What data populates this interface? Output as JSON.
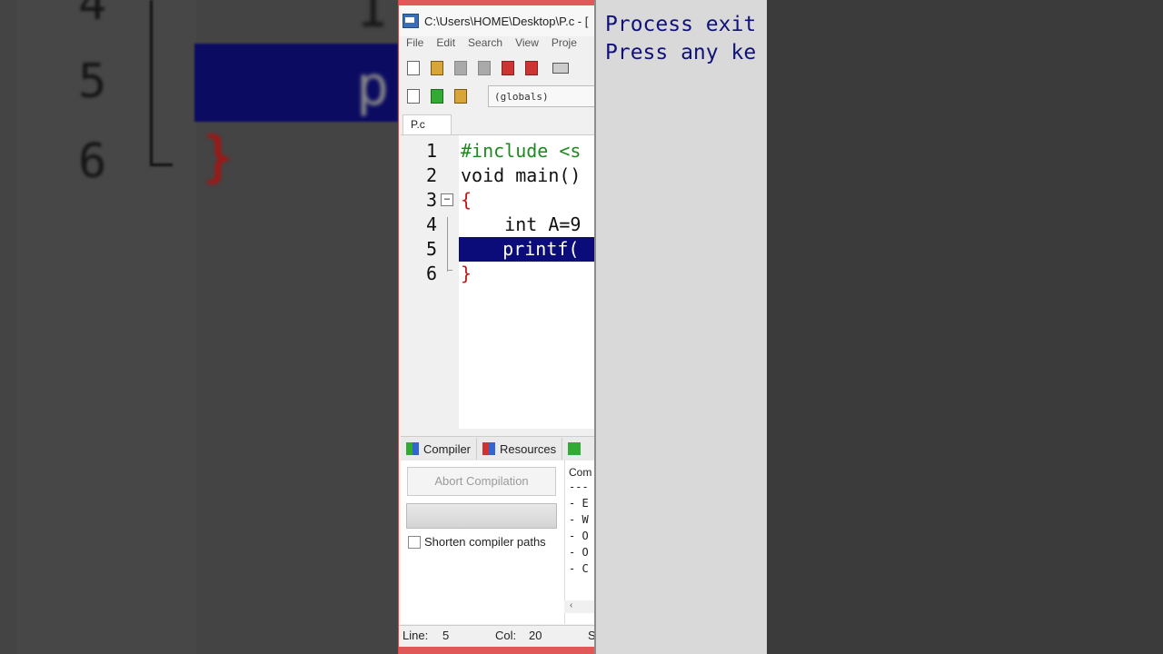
{
  "background": {
    "line_numbers": [
      "4",
      "5",
      "6"
    ],
    "code_fragments": {
      "p": "p",
      "one": "1",
      "brace": "}"
    }
  },
  "ide": {
    "title": "C:\\Users\\HOME\\Desktop\\P.c - [",
    "menu": [
      "File",
      "Edit",
      "Search",
      "View",
      "Proje"
    ],
    "globals_label": "(globals)",
    "tab_label": "P.c",
    "lines": [
      {
        "num": "1",
        "text": "#include <s"
      },
      {
        "num": "2",
        "text": "void main()"
      },
      {
        "num": "3",
        "text": "{"
      },
      {
        "num": "4",
        "text": "    int A=9"
      },
      {
        "num": "5",
        "text": "    printf("
      },
      {
        "num": "6",
        "text": "}"
      }
    ],
    "bottom_tabs": {
      "compiler": "Compiler",
      "resources": "Resources"
    },
    "abort_button": "Abort Compilation",
    "shorten_paths": "Shorten compiler paths",
    "output_header": "Com",
    "output_lines": [
      "---",
      "- E",
      "- W",
      "- O",
      "- O",
      "- C"
    ],
    "status": {
      "line_label": "Line:",
      "line_value": "5",
      "col_label": "Col:",
      "col_value": "20",
      "extra": "S"
    },
    "colors": {
      "highlight": "#0b0b7a",
      "keyword_green": "#1d8a1d",
      "brace_red": "#c01818"
    }
  },
  "console": {
    "lines": [
      "Process exit",
      "Press any ke"
    ],
    "text_color": "#11117a"
  }
}
